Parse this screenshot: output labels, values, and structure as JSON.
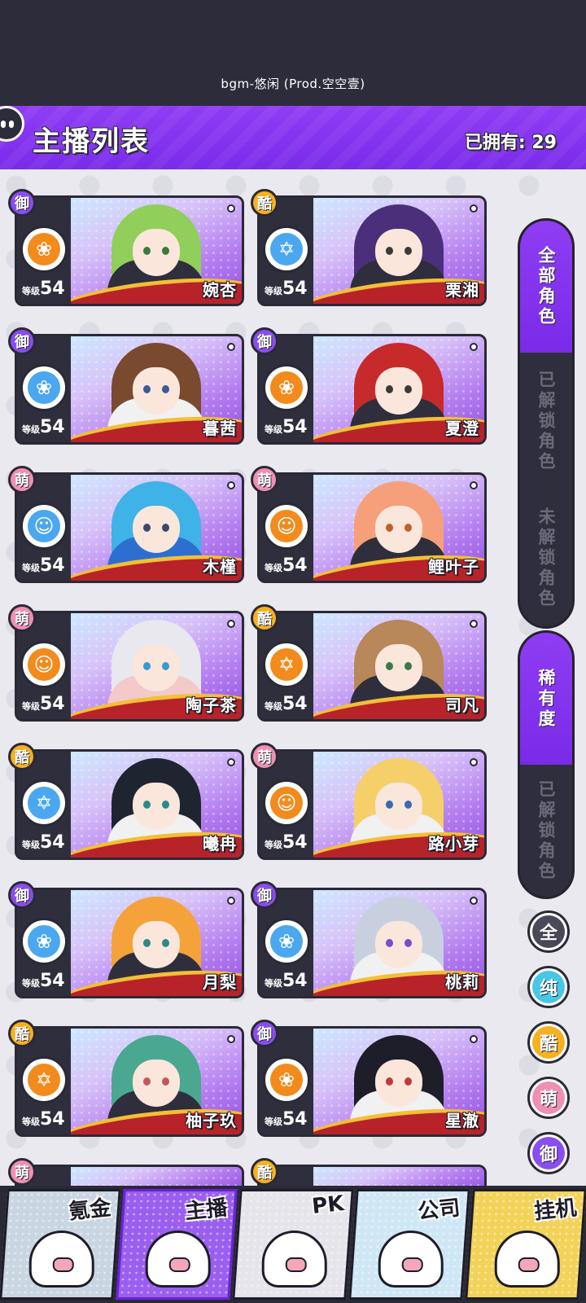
{
  "now_playing": "bgm-悠闲 (Prod.空空壹)",
  "header": {
    "title": "主播列表",
    "owned": "已拥有: 29"
  },
  "streamers": [
    {
      "name": "婉杏",
      "type": "御",
      "team_icon": "rose",
      "team_color": "#f28a1c",
      "level_label": "等级",
      "level": "54",
      "hair": "#8fcf5a",
      "eye": "#3a7a3a",
      "outfit": "#2f2e3c"
    },
    {
      "name": "栗湘",
      "type": "酷",
      "team_icon": "star",
      "team_color": "#4aa7f0",
      "level_label": "等级",
      "level": "54",
      "hair": "#4b2f7a",
      "eye": "#3a3a3a",
      "outfit": "#2f2e3c"
    },
    {
      "name": "暮茜",
      "type": "御",
      "team_icon": "rose",
      "team_color": "#4aa7f0",
      "level_label": "等级",
      "level": "54",
      "hair": "#7a4a2e",
      "eye": "#3a5a9a",
      "outfit": "#f1f1f1"
    },
    {
      "name": "夏澄",
      "type": "御",
      "team_icon": "rose",
      "team_color": "#f28a1c",
      "level_label": "等级",
      "level": "54",
      "hair": "#c72a2a",
      "eye": "#3a3a3a",
      "outfit": "#2f2e3c"
    },
    {
      "name": "木槿",
      "type": "萌",
      "team_icon": "cat",
      "team_color": "#4aa7f0",
      "level_label": "等级",
      "level": "54",
      "hair": "#3fb2e8",
      "eye": "#3a4a6a",
      "outfit": "#2d6fd0"
    },
    {
      "name": "鲤叶子",
      "type": "萌",
      "team_icon": "cat",
      "team_color": "#f28a1c",
      "level_label": "等级",
      "level": "54",
      "hair": "#f5a07a",
      "eye": "#c0602a",
      "outfit": "#2f2e3c"
    },
    {
      "name": "陶子茶",
      "type": "萌",
      "team_icon": "cat",
      "team_color": "#f28a1c",
      "level_label": "等级",
      "level": "54",
      "hair": "#e8e8ee",
      "eye": "#3a9ad0",
      "outfit": "#f3c9c9"
    },
    {
      "name": "司凡",
      "type": "酷",
      "team_icon": "star",
      "team_color": "#f28a1c",
      "level_label": "等级",
      "level": "54",
      "hair": "#b8875a",
      "eye": "#3a7a4a",
      "outfit": "#2f2e3c"
    },
    {
      "name": "曦冉",
      "type": "酷",
      "team_icon": "star",
      "team_color": "#4aa7f0",
      "level_label": "等级",
      "level": "54",
      "hair": "#1e2430",
      "eye": "#2a8a8a",
      "outfit": "#f1f1f1"
    },
    {
      "name": "路小芽",
      "type": "萌",
      "team_icon": "cat",
      "team_color": "#f28a1c",
      "level_label": "等级",
      "level": "54",
      "hair": "#f5d06a",
      "eye": "#3a6ab0",
      "outfit": "#f1f1f1"
    },
    {
      "name": "月梨",
      "type": "御",
      "team_icon": "rose",
      "team_color": "#4aa7f0",
      "level_label": "等级",
      "level": "54",
      "hair": "#f5a23a",
      "eye": "#2a8a8a",
      "outfit": "#2f2e3c"
    },
    {
      "name": "桃莉",
      "type": "御",
      "team_icon": "rose",
      "team_color": "#4aa7f0",
      "level_label": "等级",
      "level": "54",
      "hair": "#c8d0e0",
      "eye": "#7a4ad0",
      "outfit": "#f1f1f1"
    },
    {
      "name": "柚子玖",
      "type": "酷",
      "team_icon": "star",
      "team_color": "#f28a1c",
      "level_label": "等级",
      "level": "54",
      "hair": "#4aa890",
      "eye": "#c05a5a",
      "outfit": "#2f2e3c"
    },
    {
      "name": "星澈",
      "type": "御",
      "team_icon": "rose",
      "team_color": "#f28a1c",
      "level_label": "等级",
      "level": "54",
      "hair": "#1e1e2a",
      "eye": "#c03a3a",
      "outfit": "#f1f1f1"
    }
  ],
  "partial_row": [
    {
      "type": "萌"
    },
    {
      "type": "酷"
    }
  ],
  "filters": {
    "group1": [
      {
        "label": "全部角色",
        "active": true
      },
      {
        "label": "已解锁角色",
        "active": false
      },
      {
        "label": "未解锁角色",
        "active": false
      }
    ],
    "group2": [
      {
        "label": "稀有度",
        "active": true
      },
      {
        "label": "已解锁角色",
        "active": false
      }
    ],
    "types": [
      {
        "label": "全",
        "color": "#4a4958"
      },
      {
        "label": "纯",
        "color": "#47c7e6"
      },
      {
        "label": "酷",
        "color": "#f6b11f"
      },
      {
        "label": "萌",
        "color": "#f08fb4"
      },
      {
        "label": "御",
        "color": "#8a4df0"
      }
    ]
  },
  "bottom_nav": [
    {
      "label": "氪金",
      "bg": "#c9d6e2"
    },
    {
      "label": "主播",
      "bg": "#9b5ff0",
      "active": true
    },
    {
      "label": "PK",
      "bg": "#e4e4ea"
    },
    {
      "label": "公司",
      "bg": "#cfe7f5"
    },
    {
      "label": "挂机",
      "bg": "#f3d25a"
    }
  ]
}
